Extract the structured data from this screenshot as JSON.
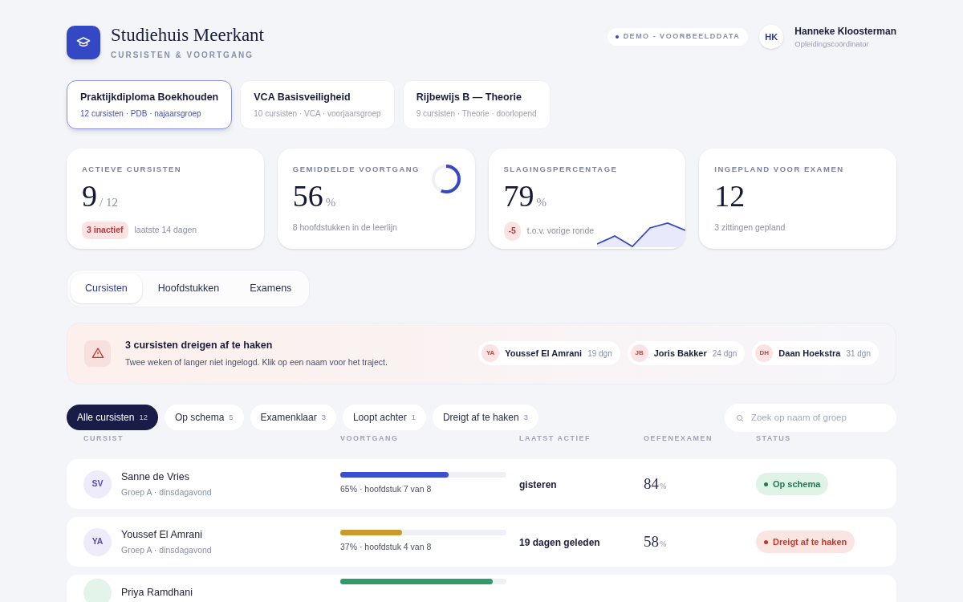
{
  "brand": {
    "title": "Studiehuis Meerkant",
    "subtitle": "CURSISTEN & VOORTGANG"
  },
  "demo_badge": "DEMO - VOORBEELDDATA",
  "user": {
    "initials": "HK",
    "name": "Hanneke Kloosterman",
    "role": "Opleidingscoördinator"
  },
  "courses": [
    {
      "title": "Praktijkdiploma Boekhouden",
      "meta": "12 cursisten · PDB · najaarsgroep",
      "selected": true
    },
    {
      "title": "VCA Basisveiligheid",
      "meta": "10 cursisten · VCA · voorjaarsgroep",
      "selected": false
    },
    {
      "title": "Rijbewijs B — Theorie",
      "meta": "9 cursisten · Theorie · doorlopend",
      "selected": false
    }
  ],
  "stats": [
    {
      "kind": "count",
      "label": "ACTIEVE CURSISTEN",
      "value": "9",
      "unit": "/ 12",
      "badge": "3 inactief",
      "note": "laatste 14 dagen"
    },
    {
      "kind": "ring",
      "label": "GEMIDDELDE VOORTGANG",
      "value": "56",
      "unit": "%",
      "note": "8 hoofdstukken in de leerlijn",
      "level": 0.56
    },
    {
      "kind": "trend",
      "label": "SLAGINGSPERCENTAGE",
      "value": "79",
      "unit": "%",
      "badge": "-5",
      "note": "t.o.v. vorige ronde"
    },
    {
      "kind": "plain",
      "label": "INGEPLAND VOOR EXAMEN",
      "value": "12",
      "note": "3 zittingen gepland"
    }
  ],
  "tabs": [
    {
      "label": "Cursisten",
      "selected": true
    },
    {
      "label": "Hoofdstukken",
      "selected": false
    },
    {
      "label": "Examens",
      "selected": false
    }
  ],
  "alert": {
    "title": "3 cursisten dreigen af te haken",
    "text": "Twee weken of langer niet ingelogd. Klik op een naam voor het traject.",
    "people": [
      {
        "initials": "YA",
        "name": "Youssef El Amrani",
        "days": "19 dgn"
      },
      {
        "initials": "JB",
        "name": "Joris Bakker",
        "days": "24 dgn"
      },
      {
        "initials": "DH",
        "name": "Daan Hoekstra",
        "days": "31 dgn"
      }
    ]
  },
  "filters": [
    {
      "label": "Alle cursisten",
      "count": "12",
      "selected": true
    },
    {
      "label": "Op schema",
      "count": "5",
      "selected": false
    },
    {
      "label": "Examenklaar",
      "count": "3",
      "selected": false
    },
    {
      "label": "Loopt achter",
      "count": "1",
      "selected": false
    },
    {
      "label": "Dreigt af te haken",
      "count": "3",
      "selected": false
    }
  ],
  "search": {
    "placeholder": "Zoek op naam of groep"
  },
  "table": {
    "columns": [
      "CURSIST",
      "VOORTGANG",
      "LAATST ACTIEF",
      "OEFENEXAMEN",
      "STATUS"
    ],
    "rows": [
      {
        "initials": "SV",
        "name": "Sanne de Vries",
        "group": "Groep A · dinsdagavond",
        "level": 0.65,
        "color": "#3b4fd0",
        "progress": "65% · hoofdstuk 7 van 8",
        "last_active": "gisteren",
        "score": "84",
        "score_unit": "%",
        "status": "Op schema",
        "kind": "on_track"
      },
      {
        "initials": "YA",
        "name": "Youssef El Amrani",
        "group": "Groep A · dinsdagavond",
        "level": 0.37,
        "color": "#c99a2e",
        "progress": "37% · hoofdstuk 4 van 8",
        "last_active": "19 dagen geleden",
        "score": "58",
        "score_unit": "%",
        "status": "Dreigt af te haken",
        "kind": "at_risk"
      },
      {
        "name": "Priya Ramdhani",
        "level": 0.92,
        "color": "#2f9a6c"
      }
    ]
  }
}
